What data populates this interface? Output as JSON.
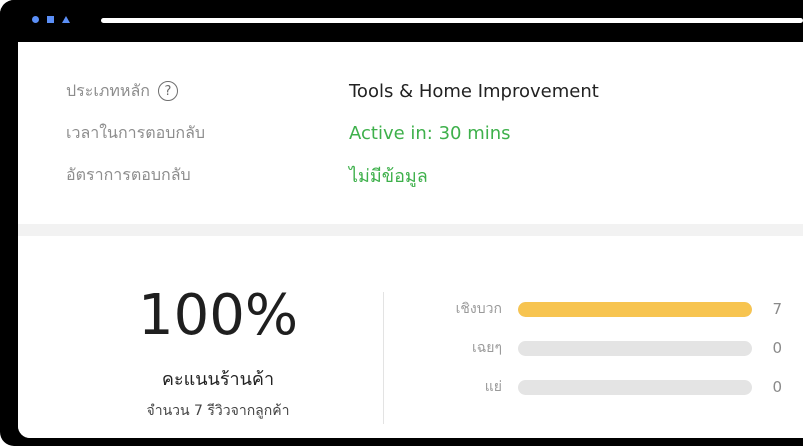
{
  "shop_info": {
    "rows": [
      {
        "label": "ประเภทหลัก",
        "value": "Tools & Home Improvement",
        "has_help": true,
        "color": "#222222"
      },
      {
        "label": "เวลาในการตอบกลับ",
        "value": "Active in: 30 mins",
        "has_help": false,
        "color": "#3eb04b"
      },
      {
        "label": "อัตราการตอบกลับ",
        "value": "ไม่มีข้อมูล",
        "has_help": false,
        "color": "#3eb04b"
      }
    ],
    "help_icon": "question-circle-icon",
    "help_glyph": "?"
  },
  "rating": {
    "score": "100%",
    "title": "คะแนนร้านค้า",
    "subtitle": "จำนวน 7 รีวิวจากลูกค้า",
    "bars": [
      {
        "label": "เชิงบวก",
        "count": "7",
        "fraction": 1.0
      },
      {
        "label": "เฉยๆ",
        "count": "0",
        "fraction": 0.0
      },
      {
        "label": "แย่",
        "count": "0",
        "fraction": 0.0
      }
    ],
    "bar_color": "#f7c450",
    "track_color": "#e4e4e4"
  }
}
